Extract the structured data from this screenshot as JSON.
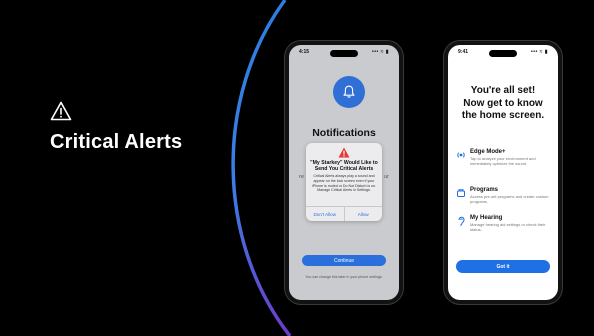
{
  "slide": {
    "title": "Critical Alerts",
    "icon": "warning-triangle-icon"
  },
  "phone1": {
    "time": "4:15",
    "signal": "••• ≈ ▮",
    "title": "Notifications",
    "side_left": "re",
    "side_right": "ur",
    "alert": {
      "title": "\"My Starkey\" Would Like to Send You Critical Alerts",
      "body": "Critical Alerts always play a sound and appear on the lock screen even if your iPhone is muted or Do Not Disturb is on. Manage Critical Alerts in Settings.",
      "deny": "Don't Allow",
      "allow": "Allow"
    },
    "continue_label": "Continue",
    "footnote": "You can change this later in your phone settings."
  },
  "phone2": {
    "time": "9:41",
    "signal": "••• ≈ ▮",
    "hero": [
      "You're all set!",
      "Now get to know",
      "the home screen."
    ],
    "features": [
      {
        "name": "Edge Mode+",
        "desc": "Tap to analyze your environment and immediately optimize the sound.",
        "icon": "edge-mode-icon"
      },
      {
        "name": "Programs",
        "desc": "Access pre-set programs and create custom programs.",
        "icon": "programs-icon"
      },
      {
        "name": "My Hearing",
        "desc": "Manage hearing aid settings or check their status.",
        "icon": "hearing-icon"
      }
    ],
    "button_label": "Got it"
  },
  "colors": {
    "background": "#000000",
    "accent_blue": "#1f6fe5",
    "arc_blue": "#2f7de0",
    "arc_purple": "#6a3cc9",
    "alert_red": "#e53935"
  }
}
